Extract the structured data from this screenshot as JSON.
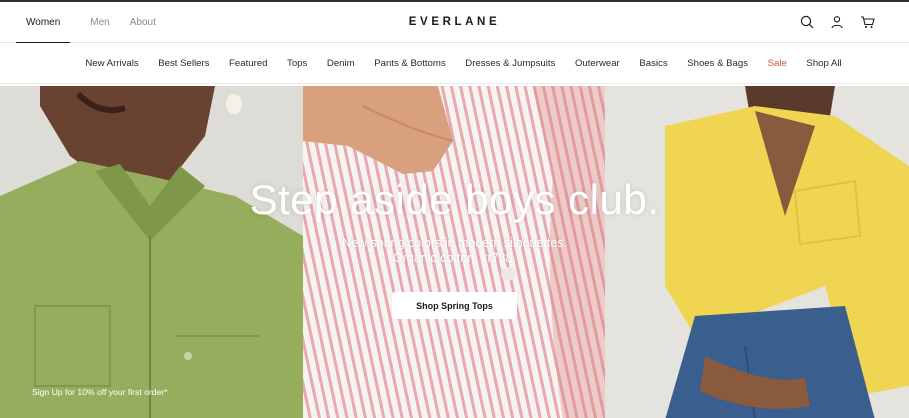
{
  "header": {
    "gender_tabs": [
      {
        "label": "Women",
        "active": true
      },
      {
        "label": "Men",
        "active": false
      },
      {
        "label": "About",
        "active": false
      }
    ],
    "logo": "EVERLANE",
    "icons": [
      "search-icon",
      "account-icon",
      "cart-icon"
    ]
  },
  "nav": {
    "categories": [
      {
        "label": "New Arrivals"
      },
      {
        "label": "Best Sellers"
      },
      {
        "label": "Featured"
      },
      {
        "label": "Tops"
      },
      {
        "label": "Denim"
      },
      {
        "label": "Pants & Bottoms"
      },
      {
        "label": "Dresses & Jumpsuits"
      },
      {
        "label": "Outerwear"
      },
      {
        "label": "Basics"
      },
      {
        "label": "Shoes & Bags"
      },
      {
        "label": "Sale"
      },
      {
        "label": "Shop All"
      }
    ]
  },
  "hero": {
    "headline": "Step aside boys club.",
    "subline_1": "New spring colors in modern silhouettes.",
    "subline_2": "Organic cotton, kr738.",
    "cta_label": "Shop Spring Tops",
    "signup_label": "Sign Up for 10% off your first order*"
  },
  "colors": {
    "sale": "#d2544a",
    "left_shirt": "#97ad5e",
    "stripe": "#e7a2a9",
    "right_shirt": "#f0d552",
    "denim": "#3a5f8f"
  }
}
